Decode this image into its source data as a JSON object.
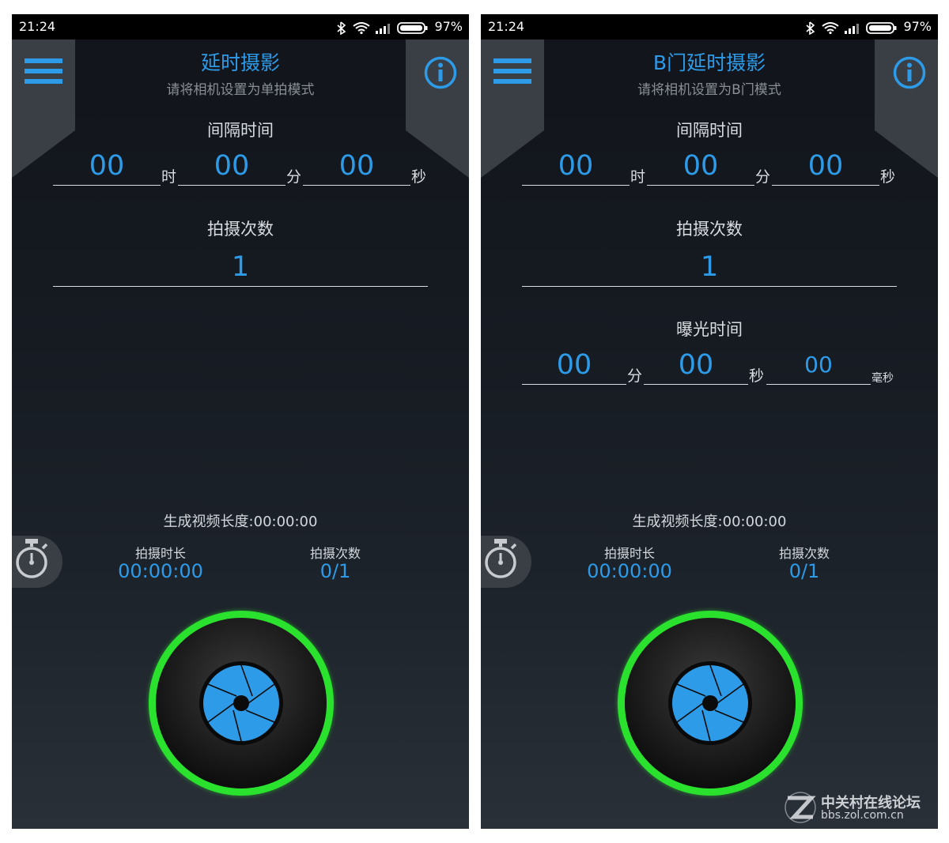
{
  "status_bar": {
    "time": "21:24",
    "battery": "97%"
  },
  "screens": [
    {
      "title": "延时摄影",
      "subtitle": "请将相机设置为单拍模式",
      "interval": {
        "label": "间隔时间",
        "hours": "00",
        "hours_unit": "时",
        "minutes": "00",
        "minutes_unit": "分",
        "seconds": "00",
        "seconds_unit": "秒"
      },
      "shots": {
        "label": "拍摄次数",
        "value": "1"
      },
      "video_length": "生成视频长度:00:00:00",
      "duration": {
        "label": "拍摄时长",
        "value": "00:00:00"
      },
      "count": {
        "label": "拍摄次数",
        "value": "0/1"
      }
    },
    {
      "title": "B门延时摄影",
      "subtitle": "请将相机设置为B门模式",
      "interval": {
        "label": "间隔时间",
        "hours": "00",
        "hours_unit": "时",
        "minutes": "00",
        "minutes_unit": "分",
        "seconds": "00",
        "seconds_unit": "秒"
      },
      "shots": {
        "label": "拍摄次数",
        "value": "1"
      },
      "exposure": {
        "label": "曝光时间",
        "minutes": "00",
        "minutes_unit": "分",
        "seconds": "00",
        "seconds_unit": "秒",
        "ms": "00",
        "ms_unit": "毫秒"
      },
      "video_length": "生成视频长度:00:00:00",
      "duration": {
        "label": "拍摄时长",
        "value": "00:00:00"
      },
      "count": {
        "label": "拍摄次数",
        "value": "0/1"
      }
    }
  ],
  "watermark": {
    "name": "中关村在线论坛",
    "url": "bbs.zol.com.cn"
  },
  "icons": [
    "menu-icon",
    "info-icon",
    "stopwatch-icon",
    "aperture-icon",
    "bluetooth-icon",
    "wifi-icon",
    "signal-icon",
    "battery-icon"
  ],
  "colors": {
    "accent": "#2d9be8",
    "ring": "#27d62b",
    "background": "#161b22"
  }
}
